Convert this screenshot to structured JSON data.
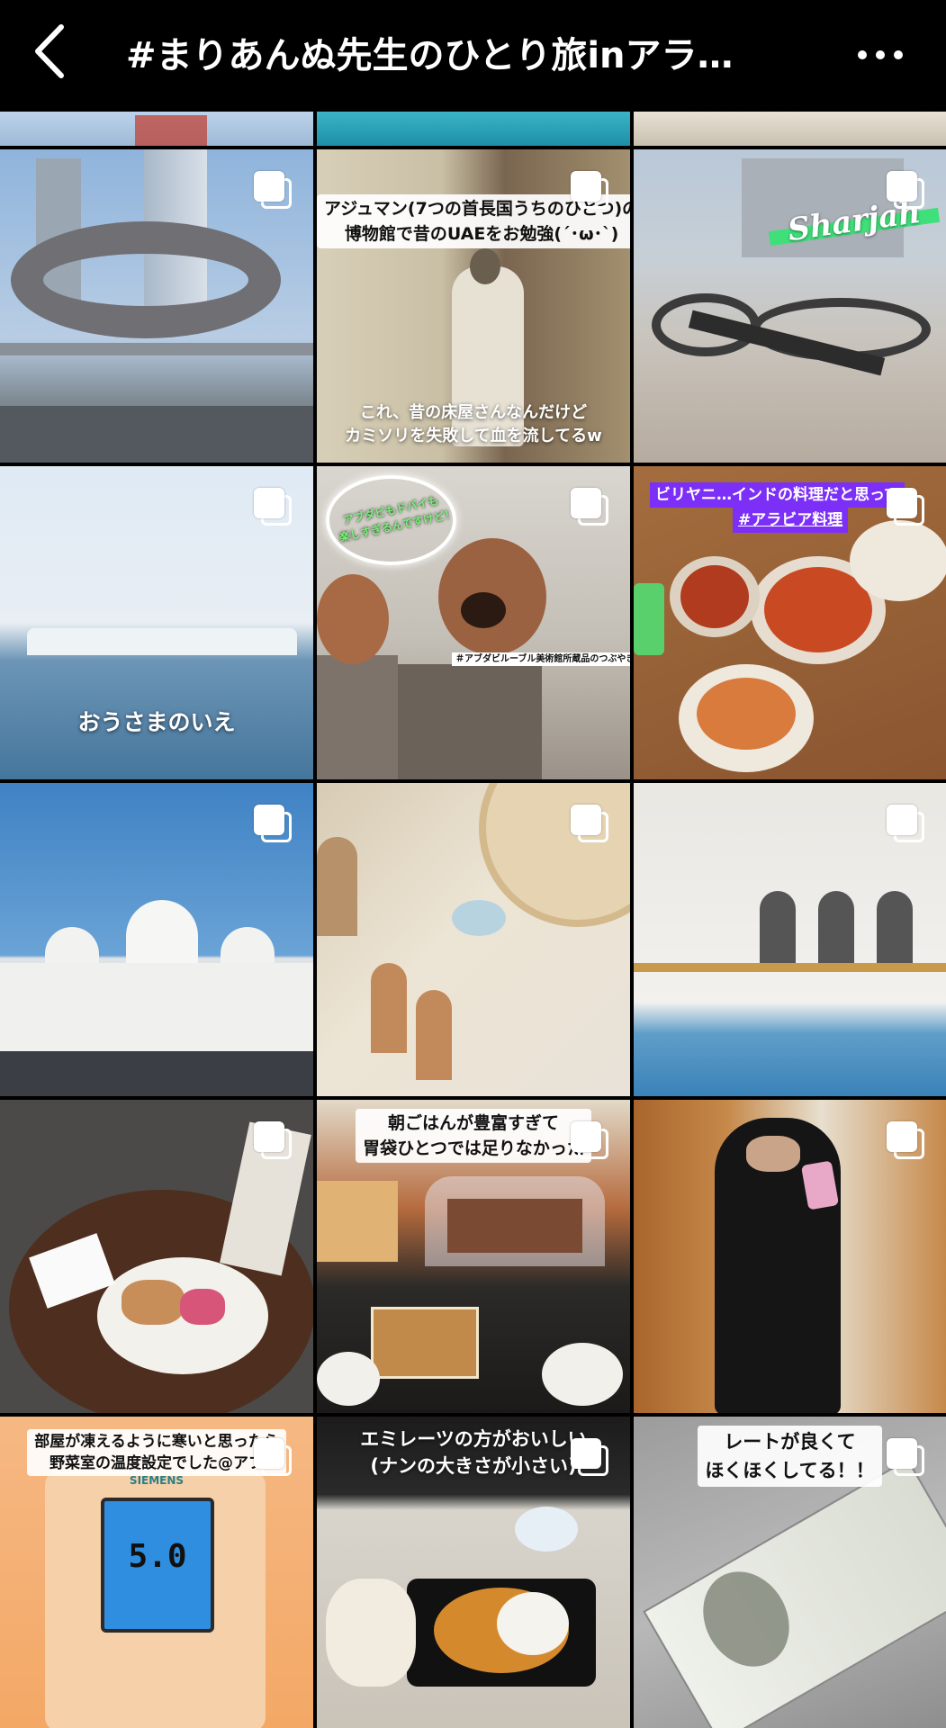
{
  "header": {
    "title": "#まりあんぬ先生のひとり旅inアラ…",
    "back_icon": "chevron-left-icon",
    "more_icon": "more-horizontal-icon"
  },
  "posts": [
    {
      "id": "museum-future",
      "multi": true,
      "caption_lines": []
    },
    {
      "id": "ajman-museum",
      "multi": true,
      "caption_top": [
        "アジュマン(7つの首長国うちのひとつ)の",
        "博物館で昔のUAEをお勉強(´･ω･`)"
      ],
      "caption_bottom": [
        "これ、昔の床屋さんなんだけど",
        "カミソリを失敗して血を流してるw"
      ]
    },
    {
      "id": "sharjah-cannons",
      "multi": true,
      "caption_top": [
        "Sharjah"
      ]
    },
    {
      "id": "palace-sea",
      "multi": true,
      "caption_bottom": [
        "おうさまのいえ"
      ]
    },
    {
      "id": "louvre-sculpture",
      "multi": true,
      "caption_top": [
        "アブダビもドバイも",
        "楽しすぎるんですけど！"
      ],
      "caption_bottom": [
        "＃アブダビルーブル美術館所蔵品のつぶやき"
      ]
    },
    {
      "id": "biryani",
      "multi": true,
      "caption_top": [
        "ビリヤニ…インドの料理だと思って",
        "#アラビア料理"
      ]
    },
    {
      "id": "mosque-exterior",
      "multi": true
    },
    {
      "id": "mosque-interior",
      "multi": true
    },
    {
      "id": "mosque-arches",
      "multi": true
    },
    {
      "id": "hotel-breakfast",
      "multi": true
    },
    {
      "id": "buffet",
      "multi": true,
      "caption_top": [
        "朝ごはんが豊富すぎて",
        "胃袋ひとつでは足りなかった"
      ]
    },
    {
      "id": "abaya-selfie",
      "multi": true
    },
    {
      "id": "thermostat",
      "multi": true,
      "caption_top": [
        "部屋が凍えるように寒いと思ったら",
        "野菜室の温度設定でした@アブ"
      ],
      "display_brand": "SIEMENS",
      "display_value": "5.0"
    },
    {
      "id": "emirates-meal",
      "multi": true,
      "caption_top": [
        "エミレーツの方がおいしい",
        "(ナンの大きさが小さい)"
      ]
    },
    {
      "id": "dollar-bill",
      "multi": true,
      "caption_top": [
        "レートが良くて",
        "ほくほくしてる！！"
      ]
    }
  ],
  "colors": {
    "biryani_label_bg": "#7b2ff7",
    "sharjah_banner": "#3fe07a"
  }
}
